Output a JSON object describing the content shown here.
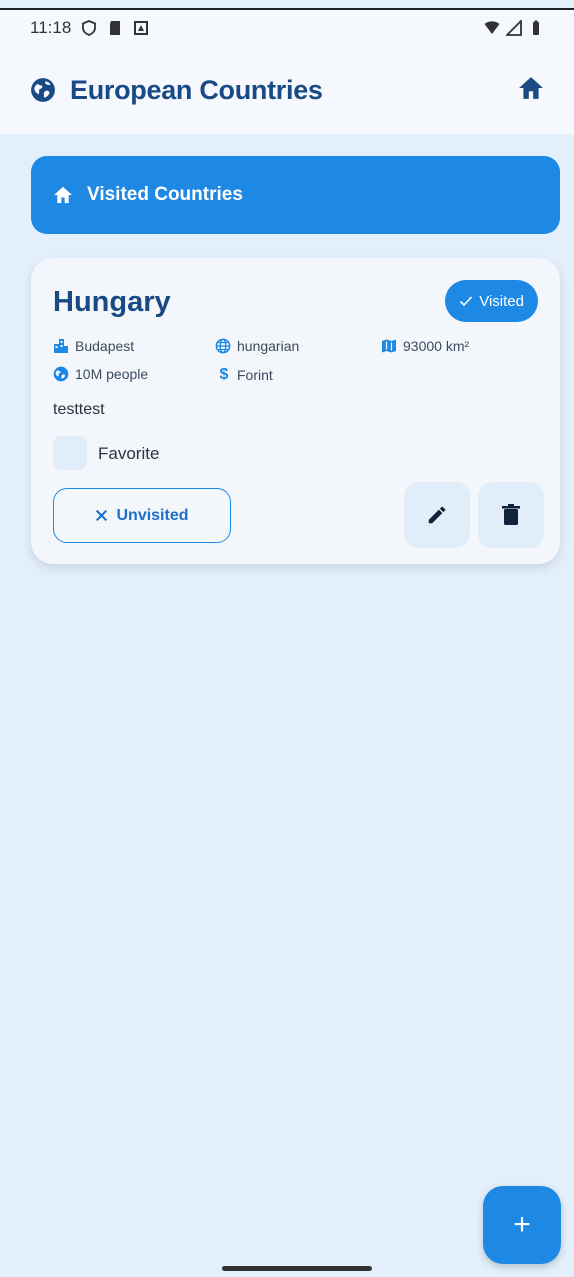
{
  "status_bar": {
    "time": "11:18"
  },
  "app_bar": {
    "title": "European Countries",
    "leading_icon": "globe-icon",
    "trailing_icon": "home-icon"
  },
  "banner": {
    "label": "Visited Countries",
    "icon": "home-icon"
  },
  "country_card": {
    "name": "Hungary",
    "badge": "Visited",
    "capital": "Budapest",
    "language": "hungarian",
    "area": "93000 km²",
    "population": "10M people",
    "currency": "Forint",
    "note": "testtest",
    "favorite_label": "Favorite",
    "unvisit_label": "Unvisited"
  },
  "fab": {
    "label": "+"
  },
  "colors": {
    "primary": "#1e88e5",
    "title": "#1a4a86",
    "background": "#e3f0fb",
    "surface": "#f3f7fb"
  }
}
